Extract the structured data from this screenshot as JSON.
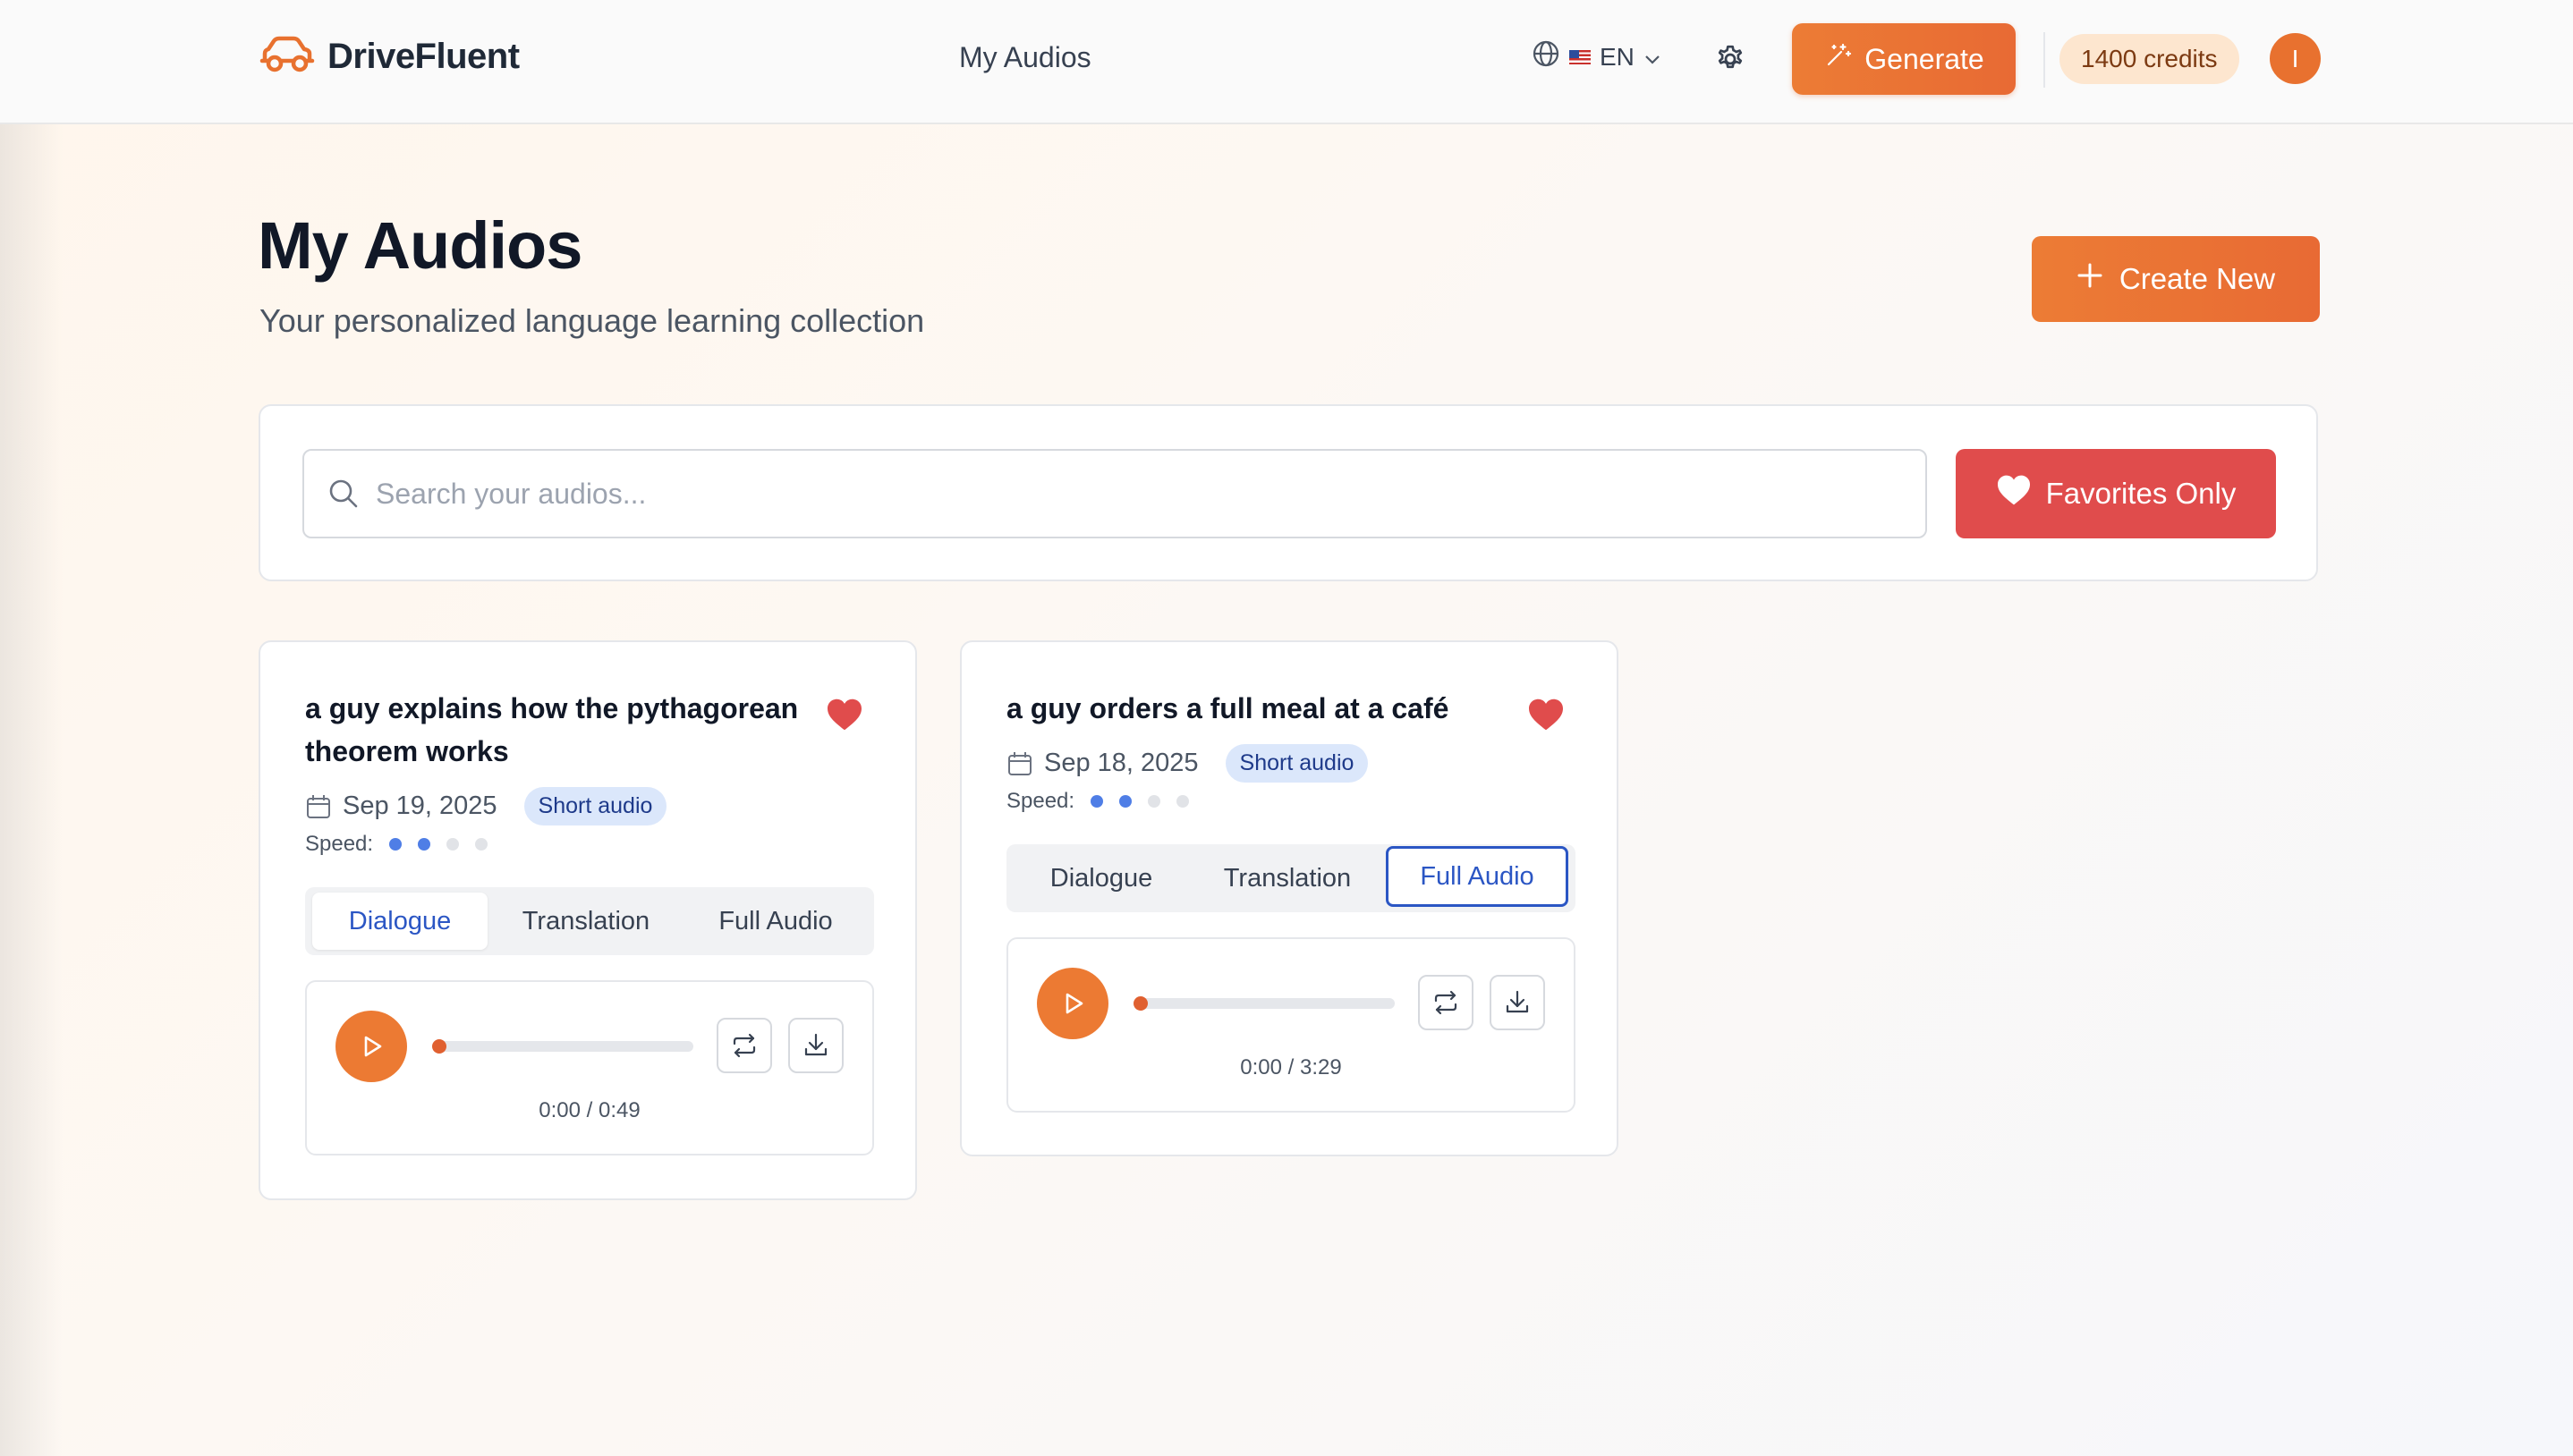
{
  "header": {
    "brand": "DriveFluent",
    "nav_link": "My Audios",
    "language": "EN",
    "generate_label": "Generate",
    "credits": "1400 credits",
    "avatar_initial": "I"
  },
  "page": {
    "title": "My Audios",
    "subtitle": "Your personalized language learning collection",
    "create_label": "Create New"
  },
  "search": {
    "placeholder": "Search your audios...",
    "favorites_label": "Favorites Only"
  },
  "colors": {
    "accent": "#e8712f",
    "favorites": "#e04c4c",
    "tab_active": "#2b56c4",
    "badge_bg": "#dbe7fb"
  },
  "cards": [
    {
      "title": "a guy explains how the pythagorean theorem works",
      "date": "Sep 19, 2025",
      "badge": "Short audio",
      "speed_label": "Speed:",
      "speed_level": 2,
      "speed_max": 4,
      "favorite": true,
      "tabs": [
        "Dialogue",
        "Translation",
        "Full Audio"
      ],
      "active_tab": "Dialogue",
      "progress": 0,
      "time": "0:00 / 0:49"
    },
    {
      "title": "a guy orders a full meal at a café",
      "date": "Sep 18, 2025",
      "badge": "Short audio",
      "speed_label": "Speed:",
      "speed_level": 2,
      "speed_max": 4,
      "favorite": true,
      "tabs": [
        "Dialogue",
        "Translation",
        "Full Audio"
      ],
      "active_tab": "Full Audio",
      "progress": 0,
      "time": "0:00 / 3:29"
    }
  ]
}
